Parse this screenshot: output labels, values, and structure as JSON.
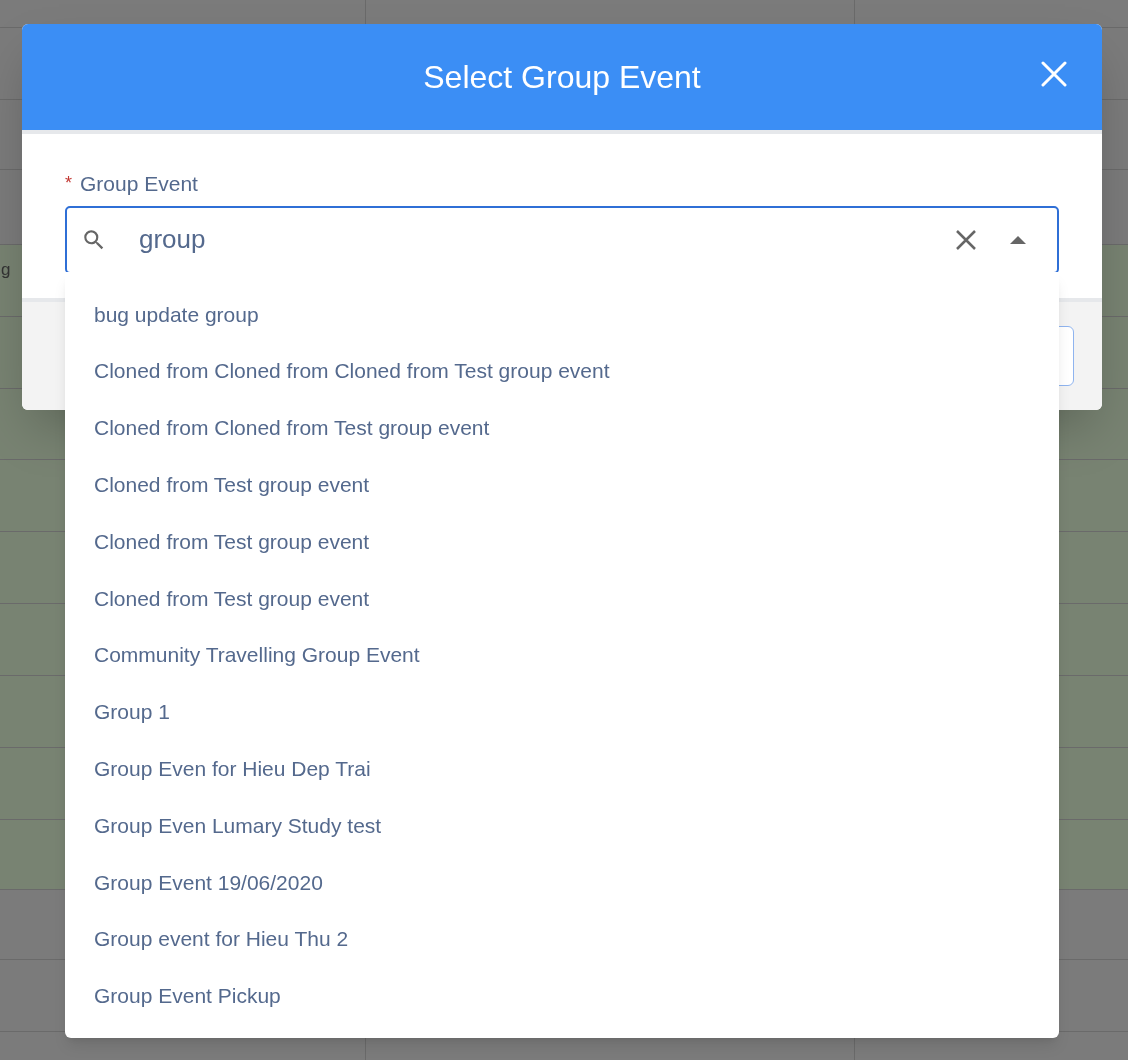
{
  "background": {
    "cell_text": "g"
  },
  "dialog": {
    "title": "Select Group Event",
    "field": {
      "label": "Group Event",
      "required_mark": "*",
      "value": "group",
      "expanded": true
    },
    "options": [
      "bug update group",
      "Cloned from Cloned from Cloned from Test group event",
      "Cloned from Cloned from Test group event",
      "Cloned from Test group event",
      "Cloned from Test group event",
      "Cloned from Test group event",
      "Community Travelling Group Event",
      "Group 1",
      "Group Even for Hieu Dep Trai",
      "Group Even Lumary Study test",
      "Group Event 19/06/2020",
      "Group event for Hieu Thu 2",
      "Group Event Pickup"
    ]
  }
}
